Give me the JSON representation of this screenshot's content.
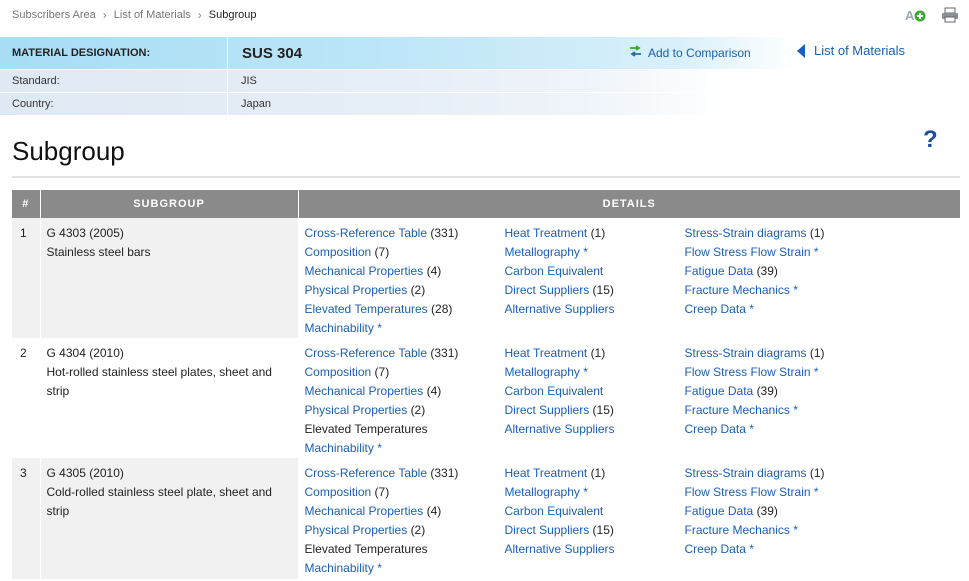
{
  "breadcrumb": [
    {
      "label": "Subscribers Area"
    },
    {
      "label": "List of Materials"
    },
    {
      "label": "Subgroup"
    }
  ],
  "icons": {
    "add": "add-font-icon",
    "print": "printer-icon"
  },
  "designation": {
    "label": "MATERIAL DESIGNATION:",
    "value": "SUS 304",
    "standard_label": "Standard:",
    "standard_value": "JIS",
    "country_label": "Country:",
    "country_value": "Japan",
    "compare_label": "Add to Comparison",
    "back_label": "List of Materials"
  },
  "page_title": "Subgroup",
  "help_glyph": "?",
  "table": {
    "headers": [
      "#",
      "SUBGROUP",
      "DETAILS"
    ],
    "rows": [
      {
        "num": "1",
        "code": "G 4303 (2005)",
        "desc": "Stainless steel bars",
        "col1": [
          {
            "label": "Cross-Reference Table",
            "count": "(331)",
            "link": true
          },
          {
            "label": "Composition",
            "count": "(7)",
            "link": true
          },
          {
            "label": "Mechanical Properties",
            "count": "(4)",
            "link": true
          },
          {
            "label": "Physical Properties",
            "count": "(2)",
            "link": true
          },
          {
            "label": "Elevated Temperatures",
            "count": "(28)",
            "link": true
          },
          {
            "label": "Machinability *",
            "count": "",
            "link": true
          }
        ],
        "col2": [
          {
            "label": "Heat Treatment",
            "count": "(1)",
            "link": true
          },
          {
            "label": "Metallography *",
            "count": "",
            "link": true
          },
          {
            "label": "Carbon Equivalent",
            "count": "",
            "link": true
          },
          {
            "label": "Direct Suppliers",
            "count": "(15)",
            "link": true
          },
          {
            "label": "Alternative Suppliers",
            "count": "",
            "link": true
          }
        ],
        "col3": [
          {
            "label": "Stress-Strain diagrams",
            "count": "(1)",
            "link": true
          },
          {
            "label": "Flow Stress Flow Strain *",
            "count": "",
            "link": true
          },
          {
            "label": "Fatigue Data",
            "count": "(39)",
            "link": true
          },
          {
            "label": "Fracture Mechanics *",
            "count": "",
            "link": true
          },
          {
            "label": "Creep Data *",
            "count": "",
            "link": true
          }
        ]
      },
      {
        "num": "2",
        "code": "G 4304 (2010)",
        "desc": "Hot-rolled stainless steel plates, sheet and strip",
        "col1": [
          {
            "label": "Cross-Reference Table",
            "count": "(331)",
            "link": true
          },
          {
            "label": "Composition",
            "count": "(7)",
            "link": true
          },
          {
            "label": "Mechanical Properties",
            "count": "(4)",
            "link": true
          },
          {
            "label": "Physical Properties",
            "count": "(2)",
            "link": true
          },
          {
            "label": "Elevated Temperatures",
            "count": "",
            "link": false
          },
          {
            "label": "Machinability *",
            "count": "",
            "link": true
          }
        ],
        "col2": [
          {
            "label": "Heat Treatment",
            "count": "(1)",
            "link": true
          },
          {
            "label": "Metallography *",
            "count": "",
            "link": true
          },
          {
            "label": "Carbon Equivalent",
            "count": "",
            "link": true
          },
          {
            "label": "Direct Suppliers",
            "count": "(15)",
            "link": true
          },
          {
            "label": "Alternative Suppliers",
            "count": "",
            "link": true
          }
        ],
        "col3": [
          {
            "label": "Stress-Strain diagrams",
            "count": "(1)",
            "link": true
          },
          {
            "label": "Flow Stress Flow Strain *",
            "count": "",
            "link": true
          },
          {
            "label": "Fatigue Data",
            "count": "(39)",
            "link": true
          },
          {
            "label": "Fracture Mechanics *",
            "count": "",
            "link": true
          },
          {
            "label": "Creep Data *",
            "count": "",
            "link": true
          }
        ]
      },
      {
        "num": "3",
        "code": "G 4305 (2010)",
        "desc": "Cold-rolled stainless steel plate, sheet and strip",
        "col1": [
          {
            "label": "Cross-Reference Table",
            "count": "(331)",
            "link": true
          },
          {
            "label": "Composition",
            "count": "(7)",
            "link": true
          },
          {
            "label": "Mechanical Properties",
            "count": "(4)",
            "link": true
          },
          {
            "label": "Physical Properties",
            "count": "(2)",
            "link": true
          },
          {
            "label": "Elevated Temperatures",
            "count": "",
            "link": false
          },
          {
            "label": "Machinability *",
            "count": "",
            "link": true
          }
        ],
        "col2": [
          {
            "label": "Heat Treatment",
            "count": "(1)",
            "link": true
          },
          {
            "label": "Metallography *",
            "count": "",
            "link": true
          },
          {
            "label": "Carbon Equivalent",
            "count": "",
            "link": true
          },
          {
            "label": "Direct Suppliers",
            "count": "(15)",
            "link": true
          },
          {
            "label": "Alternative Suppliers",
            "count": "",
            "link": true
          }
        ],
        "col3": [
          {
            "label": "Stress-Strain diagrams",
            "count": "(1)",
            "link": true
          },
          {
            "label": "Flow Stress Flow Strain *",
            "count": "",
            "link": true
          },
          {
            "label": "Fatigue Data",
            "count": "(39)",
            "link": true
          },
          {
            "label": "Fracture Mechanics *",
            "count": "",
            "link": true
          },
          {
            "label": "Creep Data *",
            "count": "",
            "link": true
          }
        ]
      }
    ]
  }
}
